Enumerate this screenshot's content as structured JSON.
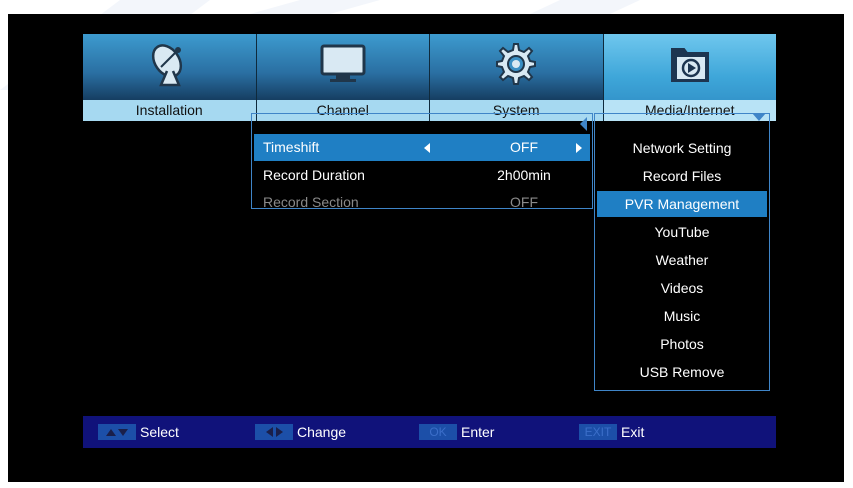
{
  "colors": {
    "accent": "#1f7fc4",
    "tab_active": "#3ea6d9",
    "tab_label_bg": "#a6d9f1",
    "panel_border": "#3f85c8",
    "helpbar_bg": "#10127a",
    "screen_bg": "#000000"
  },
  "tabs": [
    {
      "label": "Installation",
      "icon": "satellite-dish-icon",
      "active": false
    },
    {
      "label": "Channel",
      "icon": "tv-icon",
      "active": false
    },
    {
      "label": "System",
      "icon": "gear-icon",
      "active": false
    },
    {
      "label": "Media/Internet",
      "icon": "media-folder-icon",
      "active": true
    }
  ],
  "pvr_settings": [
    {
      "label": "Timeshift",
      "value": "OFF",
      "selected": true,
      "enabled": true
    },
    {
      "label": "Record Duration",
      "value": "2h00min",
      "selected": false,
      "enabled": true
    },
    {
      "label": "Record Section",
      "value": "OFF",
      "selected": false,
      "enabled": false
    }
  ],
  "submenu": [
    {
      "label": "Network Setting",
      "selected": false
    },
    {
      "label": "Record Files",
      "selected": false
    },
    {
      "label": "PVR Management",
      "selected": true
    },
    {
      "label": "YouTube",
      "selected": false
    },
    {
      "label": "Weather",
      "selected": false
    },
    {
      "label": "Videos",
      "selected": false
    },
    {
      "label": "Music",
      "selected": false
    },
    {
      "label": "Photos",
      "selected": false
    },
    {
      "label": "USB Remove",
      "selected": false
    }
  ],
  "helpbar": {
    "select_label": "Select",
    "change_label": "Change",
    "ok_key": "OK",
    "enter_label": "Enter",
    "exit_key": "EXIT",
    "exit_label": "Exit"
  }
}
